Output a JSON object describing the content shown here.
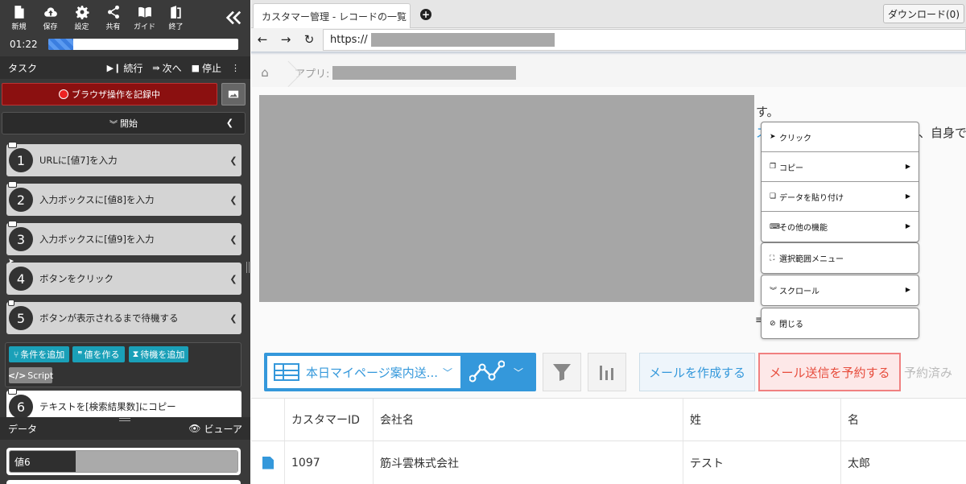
{
  "toolbar": {
    "buttons": [
      {
        "label": "新規",
        "icon": "new-file-icon"
      },
      {
        "label": "保存",
        "icon": "cloud-upload-icon"
      },
      {
        "label": "設定",
        "icon": "gear-icon"
      },
      {
        "label": "共有",
        "icon": "share-icon"
      },
      {
        "label": "ガイド",
        "icon": "book-icon"
      },
      {
        "label": "終了",
        "icon": "exit-door-icon"
      }
    ],
    "collapse_icon": "double-chevron-left-icon",
    "timer": "01:22",
    "progress_percent": 13
  },
  "task": {
    "title": "タスク",
    "continue_label": "続行",
    "next_label": "次へ",
    "stop_label": "停止",
    "record_label": "ブラウザ操作を記録中",
    "start_label": "開始",
    "steps": [
      {
        "num": "1",
        "text": "URLに[値7]を入力"
      },
      {
        "num": "2",
        "text": "入力ボックスに[値8]を入力"
      },
      {
        "num": "3",
        "text": "入力ボックスに[値9]を入力"
      },
      {
        "num": "4",
        "text": "ボタンをクリック"
      },
      {
        "num": "5",
        "text": "ボタンが表示されるまで待機する"
      },
      {
        "num": "6",
        "text": "テキストを[検索結果数]にコピー"
      }
    ],
    "actions": {
      "add_condition": "条件を追加",
      "make_value": "値を作る",
      "add_wait": "待機を追加",
      "script": "Script"
    }
  },
  "data": {
    "title": "データ",
    "viewer_label": "ビューア",
    "items": [
      {
        "key": "値6"
      }
    ]
  },
  "browser": {
    "tab_title": "カスタマー管理 - レコードの一覧",
    "download_label": "ダウンロード(0)",
    "url_prefix": "https://",
    "breadcrumb_app": "アプリ:",
    "desc_line1": "す。",
    "desc_line2": "ス",
    "desc_line3": "、自身で",
    "view_name": "本日マイページ案内送...",
    "mail_create": "メールを作成する",
    "mail_schedule": "メール送信を予約する",
    "reserved": "予約済み",
    "table": {
      "headers": [
        "カスタマーID",
        "会社名",
        "姓",
        "名"
      ],
      "rows": [
        {
          "id": "1097",
          "company": "筋斗雲株式会社",
          "last": "テスト",
          "first": "太郎"
        }
      ]
    }
  },
  "context_menu": {
    "groups": [
      [
        {
          "label": "クリック",
          "icon": "cursor-arrow-icon",
          "submenu": false
        },
        {
          "label": "コピー",
          "icon": "copy-icon",
          "submenu": true
        },
        {
          "label": "データを貼り付け",
          "icon": "paste-icon",
          "submenu": true
        },
        {
          "label": "その他の機能",
          "icon": "keyboard-icon",
          "submenu": true
        }
      ],
      [
        {
          "label": "選択範囲メニュー",
          "icon": "selection-icon",
          "submenu": false
        }
      ],
      [
        {
          "label": "スクロール",
          "icon": "double-chevron-down-icon",
          "submenu": true
        }
      ],
      [
        {
          "label": "閉じる",
          "icon": "ban-icon",
          "submenu": false
        }
      ]
    ]
  },
  "colors": {
    "record_bg": "#8b1010",
    "accent_blue": "#3498db",
    "action_teal": "#1aa0b8",
    "schedule_red": "#e74c3c"
  }
}
